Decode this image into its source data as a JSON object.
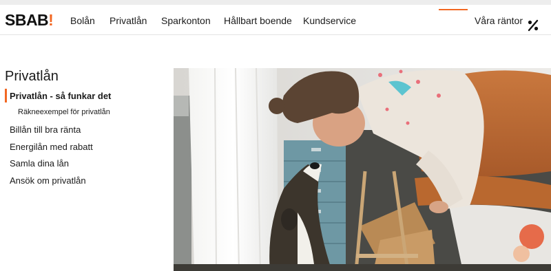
{
  "brand": {
    "name": "SBAB",
    "mark": "!"
  },
  "nav": {
    "items": [
      "Bolån",
      "Privatlån",
      "Sparkonton",
      "Hållbart boende",
      "Kundservice"
    ],
    "rates_label": "Våra räntor"
  },
  "sidebar": {
    "title": "Privatlån",
    "items": [
      {
        "label": "Privatlån - så funkar det"
      },
      {
        "label": "Räkneexempel för privatlån"
      },
      {
        "label": "Billån till bra ränta"
      },
      {
        "label": "Energilån med rabatt"
      },
      {
        "label": "Samla dina lån"
      },
      {
        "label": "Ansök om privatlån"
      }
    ]
  },
  "colors": {
    "accent": "#f26722",
    "text": "#1a1a1a",
    "cabinet": "#6e98a4"
  }
}
